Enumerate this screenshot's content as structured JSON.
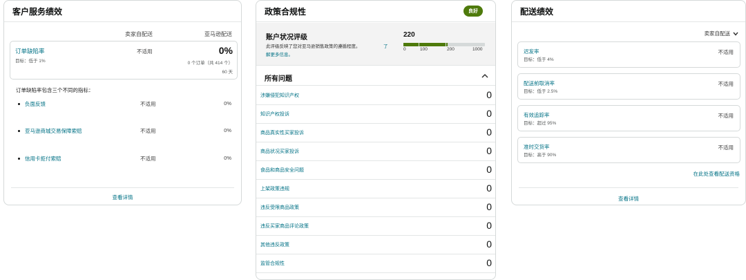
{
  "customer_service": {
    "title": "客户服务绩效",
    "col_seller": "卖家自配送",
    "col_amazon": "亚马逊配送",
    "odr": {
      "label": "订单缺陷率",
      "target": "目标：低于 1%",
      "seller_value": "不适用",
      "amazon_value": "0%",
      "amazon_detail": "0 个订单（共 414 个）",
      "amazon_days": "60 天"
    },
    "intro": "订单缺陷率包含三个不同的指标：",
    "metrics": [
      {
        "label": "负面反馈",
        "seller": "不适用",
        "amazon": "0%"
      },
      {
        "label": "亚马逊商城交易保障索赔",
        "seller": "不适用",
        "amazon": "0%"
      },
      {
        "label": "信用卡拒付索赔",
        "seller": "不适用",
        "amazon": "0%"
      }
    ],
    "details_link": "查看详情"
  },
  "policy": {
    "title": "政策合规性",
    "badge": "良好",
    "ahr": {
      "title": "账户状况评级",
      "desc_line1": "此评级反映了您对亚马逊销售政策的遵循程度。",
      "desc_link1": "了",
      "desc_link2": "解更多信息。",
      "score": "220",
      "score_value": 220,
      "ticks": [
        "0",
        "100",
        "200",
        "1000"
      ]
    },
    "issues_title": "所有问题",
    "issues": [
      {
        "label": "涉嫌侵犯知识产权",
        "count": "0"
      },
      {
        "label": "知识产权投诉",
        "count": "0"
      },
      {
        "label": "商品真实性买家投诉",
        "count": "0"
      },
      {
        "label": "商品状况买家投诉",
        "count": "0"
      },
      {
        "label": "食品和商品安全问题",
        "count": "0"
      },
      {
        "label": "上架政策违规",
        "count": "0"
      },
      {
        "label": "违反受限商品政策",
        "count": "0"
      },
      {
        "label": "违反买家商品评论政策",
        "count": "0"
      },
      {
        "label": "其他违反政策",
        "count": "0"
      },
      {
        "label": "监管合规性",
        "count": "0"
      }
    ]
  },
  "delivery": {
    "title": "配送绩效",
    "dropdown": "卖家自配送",
    "metrics": [
      {
        "label": "迟发率",
        "target": "目标：低于 4%",
        "value": "不适用"
      },
      {
        "label": "配送前取消率",
        "target": "目标：低于 2.5%",
        "value": "不适用"
      },
      {
        "label": "有效追踪率",
        "target": "目标：超过 95%",
        "value": "不适用"
      },
      {
        "label": "准时交货率",
        "target": "目标：高于 90%",
        "value": "不适用"
      }
    ],
    "eligibility_link": "在此处查看配送资格",
    "details_link": "查看详情"
  }
}
